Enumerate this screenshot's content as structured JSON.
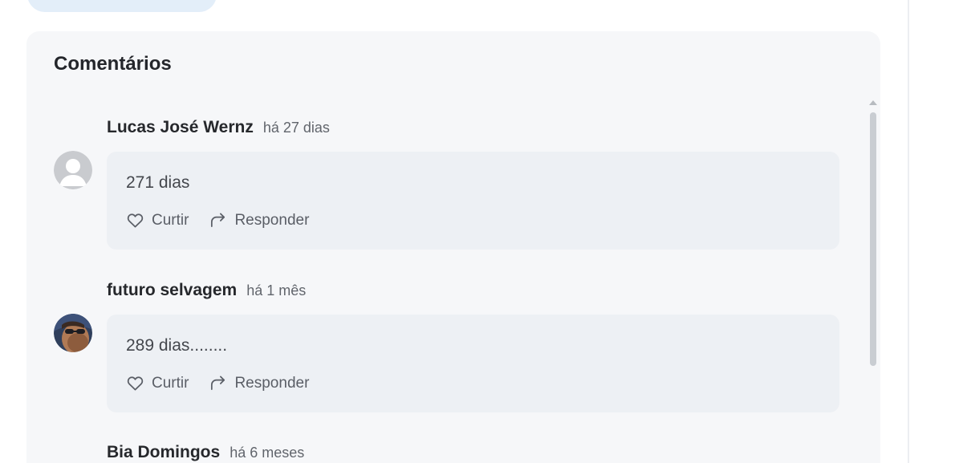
{
  "comments_section": {
    "title": "Comentários",
    "comments": [
      {
        "author": "Lucas José Wernz",
        "time": "há 27 dias",
        "text": "271 dias",
        "like_label": "Curtir",
        "reply_label": "Responder",
        "avatar": "default-user-avatar"
      },
      {
        "author": "futuro selvagem",
        "time": "há 1 mês",
        "text": "289 dias........",
        "like_label": "Curtir",
        "reply_label": "Responder",
        "avatar": "photo-avatar"
      },
      {
        "author": "Bia Domingos",
        "time": "há 6 meses"
      }
    ]
  },
  "colors": {
    "panel_background": "#f6f7f9",
    "bubble_background": "#edf0f4",
    "top_pill": "#e3eef9",
    "text_primary": "#26282c",
    "text_secondary": "#61656c"
  },
  "icons": {
    "like": "heart-icon",
    "reply": "reply-arrow-icon"
  }
}
